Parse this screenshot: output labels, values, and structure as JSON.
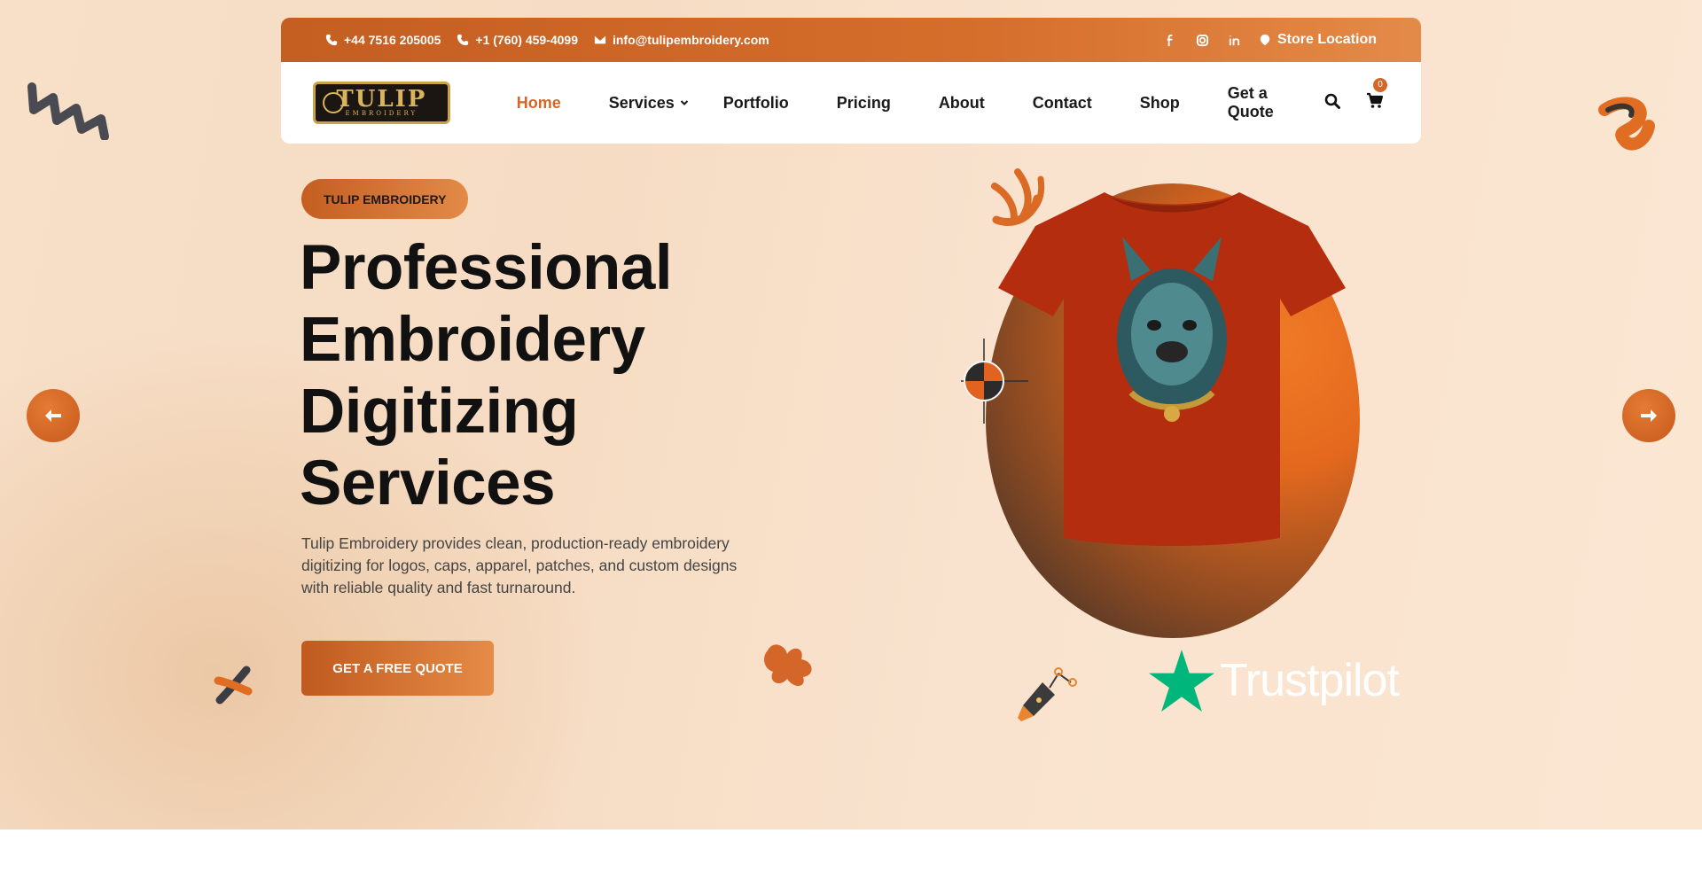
{
  "topbar": {
    "phone1": "+44 7516 205005",
    "phone2": "+1 (760) 459-4099",
    "email": "info@tulipembroidery.com",
    "store_location": "Store Location",
    "socials": [
      "facebook-icon",
      "instagram-icon",
      "linkedin-icon"
    ]
  },
  "logo": {
    "title": "TULIP",
    "subtitle": "EMBROIDERY"
  },
  "nav": {
    "items": [
      {
        "label": "Home",
        "active": true
      },
      {
        "label": "Services",
        "has_dropdown": true
      },
      {
        "label": "Portfolio"
      },
      {
        "label": "Pricing"
      },
      {
        "label": "About"
      },
      {
        "label": "Contact"
      },
      {
        "label": "Shop"
      },
      {
        "label": "Get a Quote"
      }
    ],
    "cart_count": "0"
  },
  "hero": {
    "tag": "TULIP EMBROIDERY",
    "headline": [
      "Professional",
      "Embroidery",
      "Digitizing",
      "Services"
    ],
    "description": "Tulip Embroidery provides clean, production-ready embroidery digitizing for logos, caps, apparel, patches, and custom designs with reliable quality and fast turnaround.",
    "cta": "GET A FREE QUOTE",
    "trustpilot": "Trustpilot"
  },
  "colors": {
    "accent": "#d3672a",
    "accent_dark": "#c45e21",
    "trustpilot_green": "#00b67a",
    "text_dark": "#111111"
  }
}
